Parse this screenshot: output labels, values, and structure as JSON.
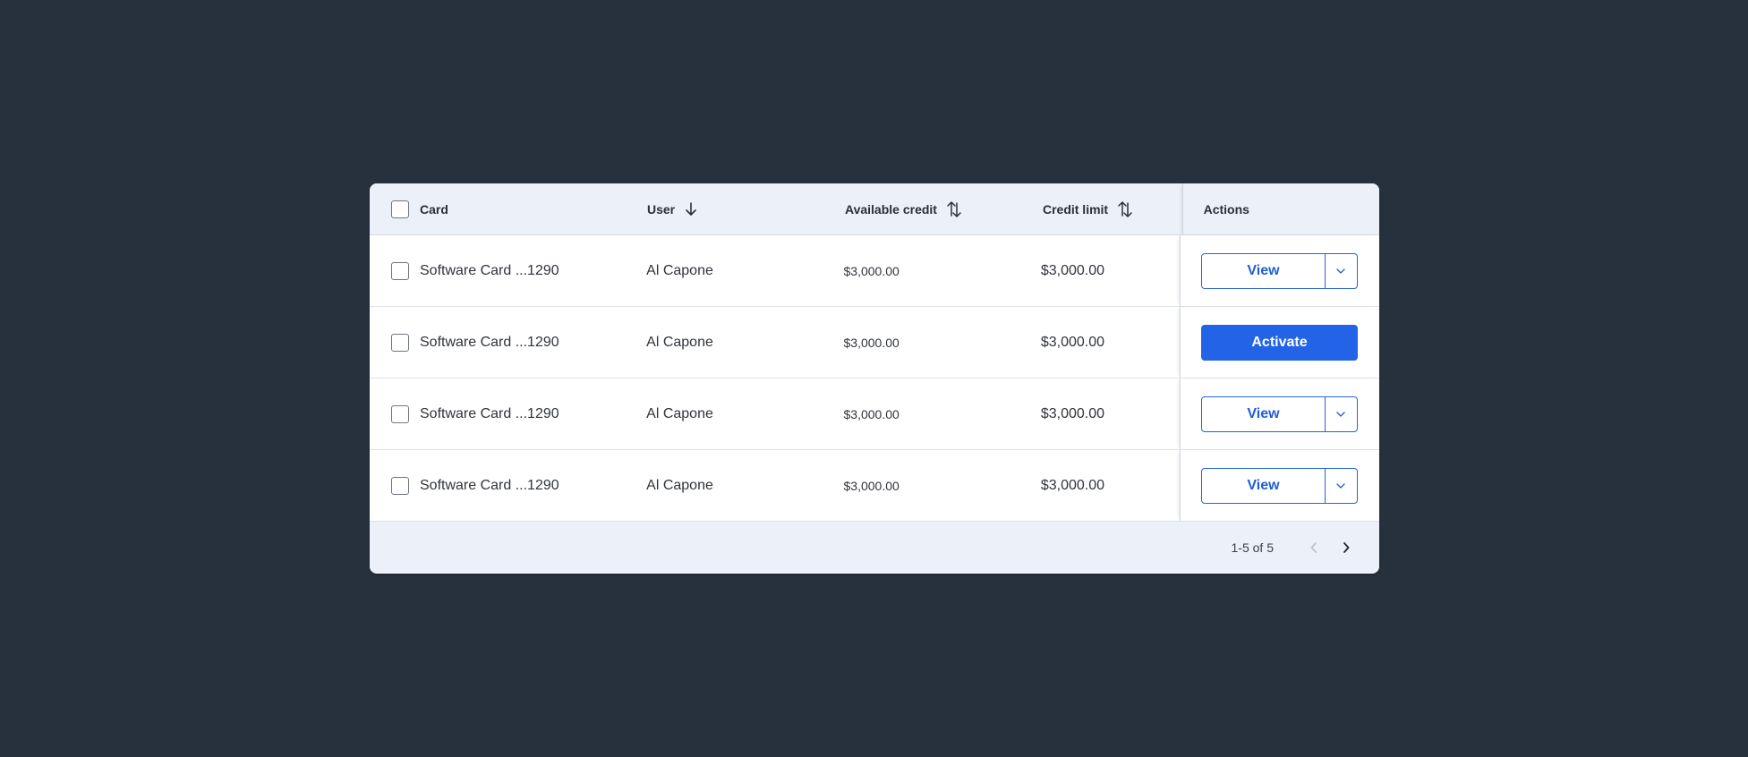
{
  "table": {
    "columns": {
      "card": "Card",
      "user": "User",
      "available_credit": "Available credit",
      "credit_limit": "Credit limit",
      "actions": "Actions"
    },
    "rows": [
      {
        "card": "Software Card ...1290",
        "user": "Al Capone",
        "available_credit": "$3,000.00",
        "credit_limit": "$3,000.00",
        "action": "View"
      },
      {
        "card": "Software Card ...1290",
        "user": "Al Capone",
        "available_credit": "$3,000.00",
        "credit_limit": "$3,000.00",
        "action": "Activate"
      },
      {
        "card": "Software Card ...1290",
        "user": "Al Capone",
        "available_credit": "$3,000.00",
        "credit_limit": "$3,000.00",
        "action": "View"
      },
      {
        "card": "Software Card ...1290",
        "user": "Al Capone",
        "available_credit": "$3,000.00",
        "credit_limit": "$3,000.00",
        "action": "View"
      }
    ]
  },
  "pagination": {
    "range": "1-5 of 5"
  },
  "icons": {
    "user_sort": "arrow-down-icon",
    "available_sort": "sort-icon",
    "limit_sort": "sort-icon",
    "row_action_menu": "chevron-down-icon",
    "prev": "chevron-left-icon",
    "next": "chevron-right-icon"
  },
  "colors": {
    "background": "#27303d",
    "header": "#ecf0f8",
    "primary": "#2363e8",
    "link": "#1f5fd6"
  }
}
